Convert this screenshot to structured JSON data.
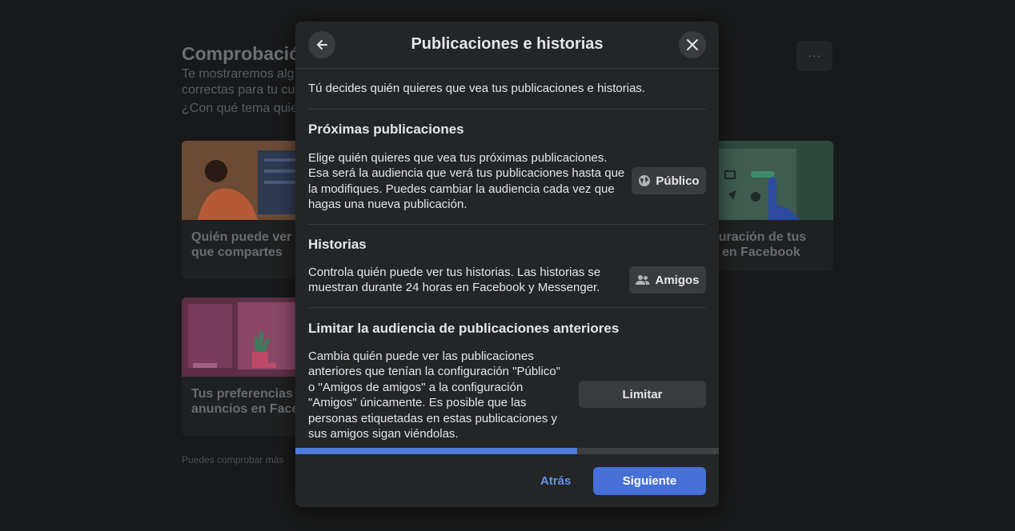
{
  "background": {
    "title": "Comprobació",
    "subtitle_lines": [
      "Te mostraremos alg",
      "correctas para tu cu",
      "¿Con qué tema quie"
    ],
    "more_label": "···",
    "cards": [
      {
        "caption_line1": "Quién puede ver l",
        "caption_line2": "que compartes"
      },
      {
        "caption_line1": "Tus preferencias",
        "caption_line2": "anuncios en Face"
      }
    ],
    "right_card": {
      "caption_line1": "guración de tus",
      "caption_line2": "en Facebook"
    },
    "footnote": "Puedes comprobar más"
  },
  "modal": {
    "title": "Publicaciones e historias",
    "intro": "Tú decides quién quieres que vea tus publicaciones e historias.",
    "sections": [
      {
        "title": "Próximas publicaciones",
        "lines": [
          "Elige quién quieres que vea tus próximas publicaciones.",
          "Esa será la audiencia que verá tus publicaciones hasta que",
          "la modifiques. Puedes cambiar la audiencia cada vez que",
          "hagas una nueva publicación."
        ],
        "button": "Público",
        "icon": "globe-icon"
      },
      {
        "title": "Historias",
        "lines": [
          "Controla quién puede ver tus historias. Las historias se",
          "muestran durante 24 horas en Facebook y Messenger."
        ],
        "button": "Amigos",
        "icon": "friends-icon"
      },
      {
        "title": "Limitar la audiencia de publicaciones anteriores",
        "lines": [
          "Cambia quién puede ver las publicaciones",
          "anteriores que tenían la configuración \"Público\"",
          "o \"Amigos de amigos\" a la configuración",
          "\"Amigos\" únicamente. Es posible que las",
          "personas etiquetadas en estas publicaciones y",
          "sus amigos sigan viéndolas."
        ],
        "button": "Limitar"
      }
    ],
    "progress": 0.665,
    "back_label": "Atrás",
    "next_label": "Siguiente"
  },
  "colors": {
    "accent": "#4670d8",
    "link": "#5d93f1",
    "surface": "#242526",
    "page": "#18191a"
  }
}
